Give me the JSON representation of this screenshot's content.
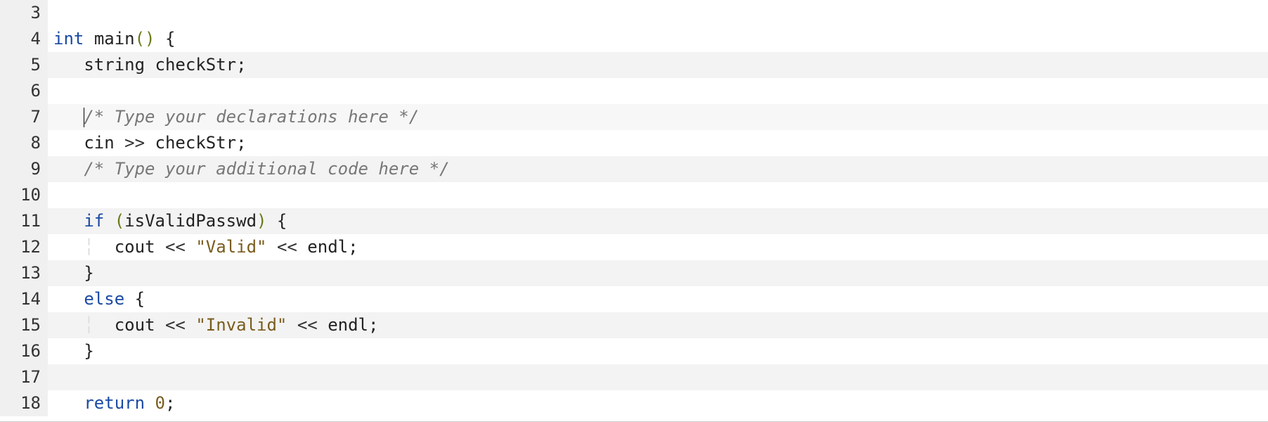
{
  "lines": [
    {
      "num": "3",
      "highlighted": false,
      "current": false,
      "tokens": []
    },
    {
      "num": "4",
      "highlighted": false,
      "current": false,
      "tokens": [
        {
          "cls": "kw",
          "t": "int"
        },
        {
          "cls": "",
          "t": " "
        },
        {
          "cls": "fn",
          "t": "main"
        },
        {
          "cls": "paren",
          "t": "()"
        },
        {
          "cls": "",
          "t": " "
        },
        {
          "cls": "brace",
          "t": "{"
        }
      ]
    },
    {
      "num": "5",
      "highlighted": true,
      "current": false,
      "tokens": [
        {
          "cls": "",
          "t": "   "
        },
        {
          "cls": "ident",
          "t": "string"
        },
        {
          "cls": "",
          "t": " "
        },
        {
          "cls": "ident",
          "t": "checkStr"
        },
        {
          "cls": "",
          "t": ";"
        }
      ]
    },
    {
      "num": "6",
      "highlighted": false,
      "current": false,
      "tokens": [
        {
          "cls": "",
          "t": "   "
        }
      ]
    },
    {
      "num": "7",
      "highlighted": true,
      "current": true,
      "tokens": [
        {
          "cls": "",
          "t": "   "
        },
        {
          "cls": "cursor",
          "t": ""
        },
        {
          "cls": "comment",
          "t": "/* Type your declarations here */"
        }
      ]
    },
    {
      "num": "8",
      "highlighted": false,
      "current": false,
      "tokens": [
        {
          "cls": "",
          "t": "   "
        },
        {
          "cls": "ident",
          "t": "cin"
        },
        {
          "cls": "",
          "t": " "
        },
        {
          "cls": "op",
          "t": ">>"
        },
        {
          "cls": "",
          "t": " "
        },
        {
          "cls": "ident",
          "t": "checkStr"
        },
        {
          "cls": "",
          "t": ";"
        }
      ]
    },
    {
      "num": "9",
      "highlighted": true,
      "current": false,
      "tokens": [
        {
          "cls": "",
          "t": "   "
        },
        {
          "cls": "comment",
          "t": "/* Type your additional code here */"
        }
      ]
    },
    {
      "num": "10",
      "highlighted": false,
      "current": false,
      "tokens": []
    },
    {
      "num": "11",
      "highlighted": true,
      "current": false,
      "tokens": [
        {
          "cls": "",
          "t": "   "
        },
        {
          "cls": "kw",
          "t": "if"
        },
        {
          "cls": "",
          "t": " "
        },
        {
          "cls": "paren",
          "t": "("
        },
        {
          "cls": "ident",
          "t": "isValidPasswd"
        },
        {
          "cls": "paren",
          "t": ")"
        },
        {
          "cls": "",
          "t": " "
        },
        {
          "cls": "brace",
          "t": "{"
        }
      ]
    },
    {
      "num": "12",
      "highlighted": false,
      "current": false,
      "tokens": [
        {
          "cls": "",
          "t": "   "
        },
        {
          "cls": "indent-guide",
          "t": "╎"
        },
        {
          "cls": "",
          "t": "  "
        },
        {
          "cls": "ident",
          "t": "cout"
        },
        {
          "cls": "",
          "t": " "
        },
        {
          "cls": "op",
          "t": "<<"
        },
        {
          "cls": "",
          "t": " "
        },
        {
          "cls": "str",
          "t": "\"Valid\""
        },
        {
          "cls": "",
          "t": " "
        },
        {
          "cls": "op",
          "t": "<<"
        },
        {
          "cls": "",
          "t": " "
        },
        {
          "cls": "ident",
          "t": "endl"
        },
        {
          "cls": "",
          "t": ";"
        }
      ]
    },
    {
      "num": "13",
      "highlighted": true,
      "current": false,
      "tokens": [
        {
          "cls": "",
          "t": "   "
        },
        {
          "cls": "brace",
          "t": "}"
        }
      ]
    },
    {
      "num": "14",
      "highlighted": false,
      "current": false,
      "tokens": [
        {
          "cls": "",
          "t": "   "
        },
        {
          "cls": "kw",
          "t": "else"
        },
        {
          "cls": "",
          "t": " "
        },
        {
          "cls": "brace",
          "t": "{"
        }
      ]
    },
    {
      "num": "15",
      "highlighted": true,
      "current": false,
      "tokens": [
        {
          "cls": "",
          "t": "   "
        },
        {
          "cls": "indent-guide",
          "t": "╎"
        },
        {
          "cls": "",
          "t": "  "
        },
        {
          "cls": "ident",
          "t": "cout"
        },
        {
          "cls": "",
          "t": " "
        },
        {
          "cls": "op",
          "t": "<<"
        },
        {
          "cls": "",
          "t": " "
        },
        {
          "cls": "str",
          "t": "\"Invalid\""
        },
        {
          "cls": "",
          "t": " "
        },
        {
          "cls": "op",
          "t": "<<"
        },
        {
          "cls": "",
          "t": " "
        },
        {
          "cls": "ident",
          "t": "endl"
        },
        {
          "cls": "",
          "t": ";"
        }
      ]
    },
    {
      "num": "16",
      "highlighted": false,
      "current": false,
      "tokens": [
        {
          "cls": "",
          "t": "   "
        },
        {
          "cls": "brace",
          "t": "}"
        }
      ]
    },
    {
      "num": "17",
      "highlighted": true,
      "current": false,
      "tokens": []
    },
    {
      "num": "18",
      "highlighted": false,
      "current": false,
      "tokens": [
        {
          "cls": "",
          "t": "   "
        },
        {
          "cls": "kw",
          "t": "return"
        },
        {
          "cls": "",
          "t": " "
        },
        {
          "cls": "num",
          "t": "0"
        },
        {
          "cls": "",
          "t": ";"
        }
      ]
    }
  ]
}
